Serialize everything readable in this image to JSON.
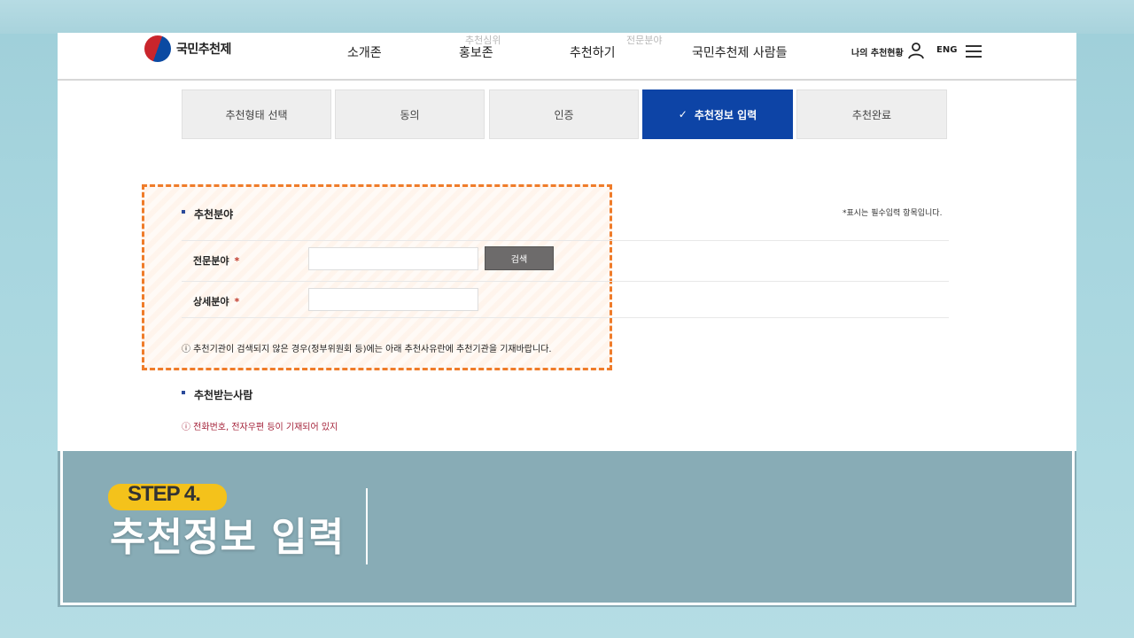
{
  "header": {
    "logo_text": "국민추천제",
    "nav": [
      "소개존",
      "홍보존",
      "추천하기",
      "국민추천제 사람들"
    ],
    "my_status": "나의 추천현황",
    "lang": "ENG"
  },
  "background": {
    "ghost_labels": [
      "추천심위",
      "전문분야"
    ]
  },
  "steps": [
    {
      "label": "추천형태 선택",
      "active": false
    },
    {
      "label": "동의",
      "active": false
    },
    {
      "label": "인증",
      "active": false
    },
    {
      "label": "추천정보 입력",
      "active": true,
      "check": "✓"
    },
    {
      "label": "추천완료",
      "active": false
    }
  ],
  "form": {
    "section1_title": "추천분야",
    "required_note": "*표시는 필수입력 항목입니다.",
    "field1_label": "전문분야",
    "field1_value": "",
    "field2_label": "상세분야",
    "field2_value": "",
    "required_mark": "*",
    "search_button": "검색",
    "notice1": "ⓘ 추천기관이 검색되지 않은 경우(정부위원회 등)에는 아래 추천사유란에 추천기관을 기재바랍니다.",
    "section2_title": "추천받는사람",
    "notice2": "ⓘ 전화번호, 전자우편 등이 기재되어 있지"
  },
  "overlay": {
    "step_badge": "STEP 4.",
    "step_title": "추천정보 입력"
  },
  "colors": {
    "active_step": "#0d44a6",
    "highlight_border": "#ef7c2a",
    "badge": "#f4c21b"
  }
}
